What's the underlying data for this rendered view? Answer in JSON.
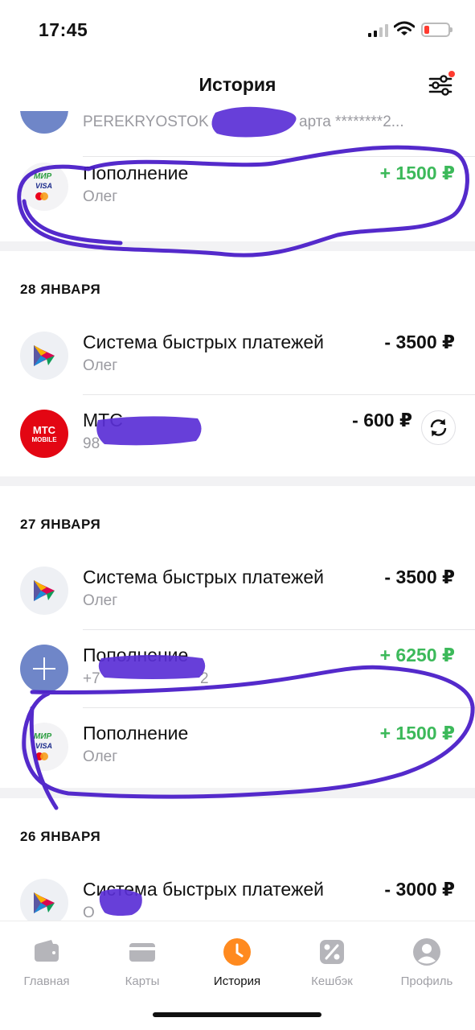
{
  "status_bar": {
    "time": "17:45"
  },
  "header": {
    "title": "История"
  },
  "top_partial": {
    "subtitle": "PEREKRYOSTOK",
    "subtitle_tail": "арта ********2..."
  },
  "groups": [
    {
      "transactions": [
        {
          "title": "Пополнение",
          "subtitle": "Олег",
          "amount": "+ 1500 ₽",
          "type": "positive",
          "icon": "mir-visa-mastercard-icon"
        }
      ]
    },
    {
      "date": "28 ЯНВАРЯ",
      "transactions": [
        {
          "title": "Система быстрых платежей",
          "subtitle": "Олег",
          "amount": "- 3500 ₽",
          "type": "negative",
          "icon": "sbp-icon"
        },
        {
          "title": "МТС",
          "subtitle": "98",
          "amount": "- 600 ₽",
          "type": "negative",
          "icon": "mts-logo"
        }
      ]
    },
    {
      "date": "27 ЯНВАРЯ",
      "transactions": [
        {
          "title": "Система быстрых платежей",
          "subtitle": "Олег",
          "amount": "- 3500 ₽",
          "type": "negative",
          "icon": "sbp-icon"
        },
        {
          "title": "Пополнение",
          "subtitle": "+7",
          "subtitle_tail": "2",
          "amount": "+ 6250 ₽",
          "type": "positive",
          "icon": "plus-icon"
        },
        {
          "title": "Пополнение",
          "subtitle": "Олег",
          "amount": "+ 1500 ₽",
          "type": "positive",
          "icon": "mir-visa-mastercard-icon"
        }
      ]
    },
    {
      "date": "26 ЯНВАРЯ",
      "transactions": [
        {
          "title": "Система быстрых платежей",
          "subtitle": "О",
          "amount": "- 3000 ₽",
          "type": "negative",
          "icon": "sbp-icon"
        }
      ]
    }
  ],
  "mts_logo": {
    "line1": "МТС",
    "line2": "MOBILE"
  },
  "card_logos": {
    "mir": "МИР",
    "visa": "VISA"
  },
  "tabbar": {
    "items": [
      {
        "label": "Главная",
        "icon": "wallet-icon"
      },
      {
        "label": "Карты",
        "icon": "card-icon"
      },
      {
        "label": "История",
        "icon": "clock-icon",
        "active": true
      },
      {
        "label": "Кешбэк",
        "icon": "percent-icon"
      },
      {
        "label": "Профиль",
        "icon": "profile-icon"
      }
    ]
  },
  "colors": {
    "positive": "#3cb95a",
    "accent": "#ff8a1f",
    "scribble": "#4b1fc8",
    "mts": "#e30613"
  }
}
